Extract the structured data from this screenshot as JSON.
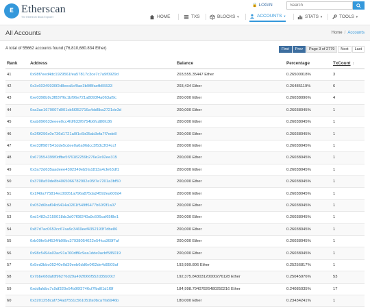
{
  "logo": {
    "name": "Etherscan",
    "tagline": "The Ethereum Block Explorer",
    "mark": "E"
  },
  "header": {
    "login": "LOGIN",
    "search_placeholder": "Search"
  },
  "nav": [
    {
      "label": "HOME",
      "icon": "home-icon"
    },
    {
      "label": "TXS",
      "icon": "list-icon"
    },
    {
      "label": "BLOCKS",
      "icon": "cube-icon"
    },
    {
      "label": "ACCOUNTS",
      "icon": "user-icon"
    },
    {
      "label": "STATS",
      "icon": "chart-icon"
    },
    {
      "label": "TOOLS",
      "icon": "wrench-icon"
    }
  ],
  "page": {
    "title": "All Accounts",
    "crumb_home": "Home",
    "crumb_current": "Accounts"
  },
  "summary": "A total of 55662 accounts found (76,810,680.834 Ether)",
  "pager": {
    "first": "First",
    "prev": "Prev",
    "page_info": "Page 3 of 2779",
    "next": "Next",
    "last": "Last"
  },
  "table": {
    "headers": {
      "rank": "Rank",
      "address": "Address",
      "balance": "Balance",
      "percentage": "Percentage",
      "txcount": "TxCount"
    },
    "rows": [
      {
        "rank": "41",
        "address": "0x98f7eed4dc1929561fea57817c3ce7c7a9f0929d",
        "balance": "203,555.35447 Ether",
        "pct": "0.26500918%",
        "tx": "3"
      },
      {
        "rank": "42",
        "address": "0x3c60349930f2d8eea5cf9ae3b9f8faefb55533",
        "balance": "203,434 Ether",
        "pct": "0.26485119%",
        "tx": "6"
      },
      {
        "rank": "43",
        "address": "0xe0398b9c3f837f6c1bf96e721a8093f4a063af9c",
        "balance": "200,000 Ether",
        "pct": "0.26038096%",
        "tx": "4"
      },
      {
        "rank": "44",
        "address": "0xa3ae1679007d901cb5f352716a4dd5ba2721de3d",
        "balance": "200,000 Ether",
        "pct": "0.26038045%",
        "tx": "1"
      },
      {
        "rank": "45",
        "address": "0xab096633eeee0cc4fdf632f6754b6fcd80fc86",
        "balance": "200,000 Ether",
        "pct": "0.26038045%",
        "tx": "1"
      },
      {
        "rank": "46",
        "address": "0x2f9f296c0e736d1721a0f1c6b05ab3efa7f7ede8",
        "balance": "200,000 Ether",
        "pct": "0.26038045%",
        "tx": "1"
      },
      {
        "rank": "47",
        "address": "0xe33ff987541dde5cdee0a6a06dcc3f53c3f24ccf",
        "balance": "200,000 Ether",
        "pct": "0.26038045%",
        "tx": "1"
      },
      {
        "rank": "48",
        "address": "0x673554399f0dfbe5f76182259b276e2e92ee315",
        "balance": "200,000 Ether",
        "pct": "0.26038045%",
        "tx": "1"
      },
      {
        "rank": "49",
        "address": "0x3a72d635aadeee4302349eb5fa1813a4cfe63df1",
        "balance": "200,000 Ether",
        "pct": "0.26038045%",
        "tx": "1"
      },
      {
        "rank": "50",
        "address": "0x3708a59de8b4065066782902e05f7e7201a3bf50",
        "balance": "200,000 Ether",
        "pct": "0.26038045%",
        "tx": "1"
      },
      {
        "rank": "51",
        "address": "0x1f49a775814ec00051a796a875da24592ea600d4",
        "balance": "200,000 Ether",
        "pct": "0.26038045%",
        "tx": "1"
      },
      {
        "rank": "52",
        "address": "0x052d6baf04b5414a0261f549ff6477b60f2f1a07",
        "balance": "200,000 Ether",
        "pct": "0.26038045%",
        "tx": "1"
      },
      {
        "rank": "53",
        "address": "0xd1482c2159018dc3d07f08240a9c606caf65f8e1",
        "balance": "200,000 Ether",
        "pct": "0.26038045%",
        "tx": "1"
      },
      {
        "rank": "54",
        "address": "0x87d7ac0653cc67aa9c3469eef4352193f7dbe86",
        "balance": "200,000 Ether",
        "pct": "0.26038045%",
        "tx": "1"
      },
      {
        "rank": "55",
        "address": "0xb09fe6d4534fb99bc37938054022e54fca369f7af",
        "balance": "200,000 Ether",
        "pct": "0.26038045%",
        "tx": "1"
      },
      {
        "rank": "56",
        "address": "0x98c5494a03ac91a760dff6c9ea1dde0acbf585019",
        "balance": "200,000 Ether",
        "pct": "0.26038045%",
        "tx": "1"
      },
      {
        "rank": "57",
        "address": "0x5ed3bbc05240e0d39eeb6dd6e0f62de4d9509af",
        "balance": "193,999.806 Ether",
        "pct": "0.25256817%",
        "tx": "1"
      },
      {
        "rank": "58",
        "address": "0x7bbe68dafdf96276d29a492f066f552d35b00cf",
        "balance": "192,375.84303120000276128 Ether",
        "pct": "0.25045976%",
        "tx": "53"
      },
      {
        "rank": "59",
        "address": "0xddfafdbc7c9df320e54b96f3746cf7fbd01d1f9f",
        "balance": "184,998.79407826480250216 Ether",
        "pct": "0.24085035%",
        "tx": "17"
      },
      {
        "rank": "60",
        "address": "0x3201258caf734ad7551c561051fa0bca7fa6946b",
        "balance": "180,000 Ether",
        "pct": "0.23434241%",
        "tx": "1"
      }
    ]
  }
}
